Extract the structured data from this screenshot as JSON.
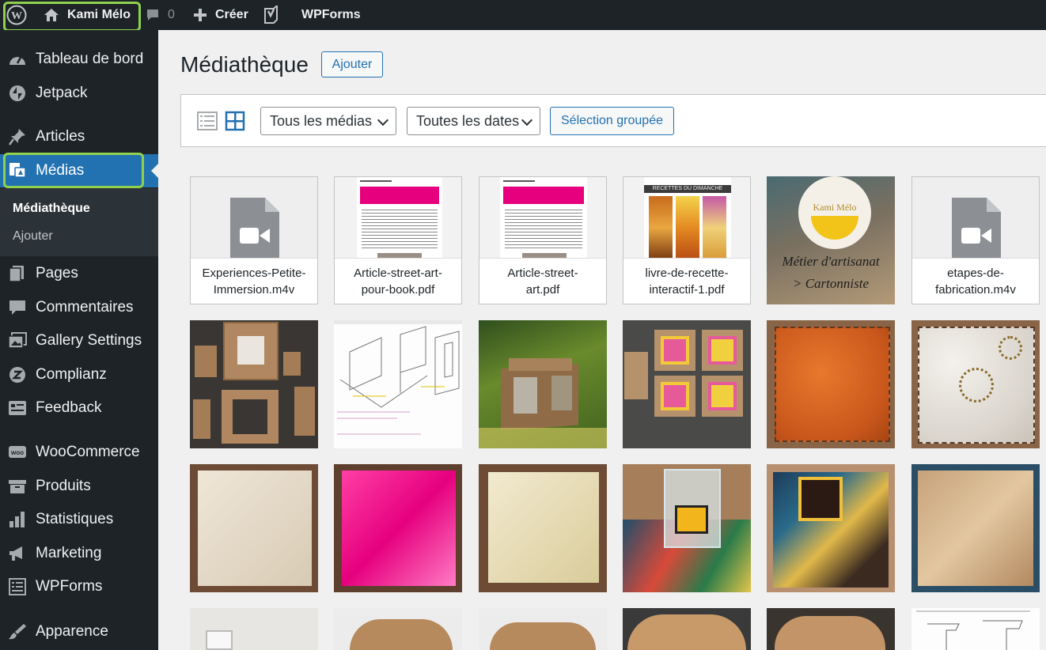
{
  "admin_bar": {
    "site_name": "Kami Mélo",
    "comments_count": "0",
    "new_label": "Créer",
    "wpforms_label": "WPForms"
  },
  "sidebar": {
    "items": [
      {
        "label": "Tableau de bord",
        "icon": "dashboard-icon"
      },
      {
        "label": "Jetpack",
        "icon": "jetpack-icon"
      },
      {
        "label": "Articles",
        "icon": "pin-icon"
      },
      {
        "label": "Médias",
        "icon": "media-icon"
      },
      {
        "label": "Pages",
        "icon": "pages-icon"
      },
      {
        "label": "Commentaires",
        "icon": "comments-icon"
      },
      {
        "label": "Gallery Settings",
        "icon": "gallery-icon"
      },
      {
        "label": "Complianz",
        "icon": "complianz-icon"
      },
      {
        "label": "Feedback",
        "icon": "feedback-icon"
      },
      {
        "label": "WooCommerce",
        "icon": "woocommerce-icon"
      },
      {
        "label": "Produits",
        "icon": "products-icon"
      },
      {
        "label": "Statistiques",
        "icon": "stats-icon"
      },
      {
        "label": "Marketing",
        "icon": "megaphone-icon"
      },
      {
        "label": "WPForms",
        "icon": "wpforms-icon"
      },
      {
        "label": "Apparence",
        "icon": "brush-icon"
      }
    ],
    "submenu": [
      "Médiathèque",
      "Ajouter"
    ]
  },
  "page": {
    "title": "Médiathèque",
    "add_button": "Ajouter"
  },
  "filters": {
    "type_select": "Tous les médias",
    "date_select": "Toutes les dates",
    "bulk_button": "Sélection groupée"
  },
  "files": [
    {
      "name": "Experiences-Petite-Immersion.m4v",
      "line1": "Experiences-Petite-",
      "line2": "Immersion.m4v",
      "kind": "video"
    },
    {
      "name": "Article-street-art-pour-book.pdf",
      "line1": "Article-street-art-",
      "line2": "pour-book.pdf",
      "kind": "pdf"
    },
    {
      "name": "Article-street-art.pdf",
      "line1": "Article-street-",
      "line2": "art.pdf",
      "kind": "pdf"
    },
    {
      "name": "livre-de-recette-interactif-1.pdf",
      "line1": "livre-de-recette-",
      "line2": "interactif-1.pdf",
      "kind": "pdf"
    },
    {
      "name": "etapes-de-fabrication.m4v",
      "line1": "etapes-de-",
      "line2": "fabrication.m4v",
      "kind": "video"
    }
  ],
  "image_tile_texts": {
    "logo_text": "Kami Mélo",
    "tagline_1": "Métier d'artisanat",
    "tagline_2": "> Cartonniste",
    "recipe_header": "RECETTES DU DIMANCHE"
  },
  "colors": {
    "admin_bar": "#1d2327",
    "sidebar": "#1d2327",
    "accent": "#2271b1",
    "highlight": "#8fd14f"
  }
}
